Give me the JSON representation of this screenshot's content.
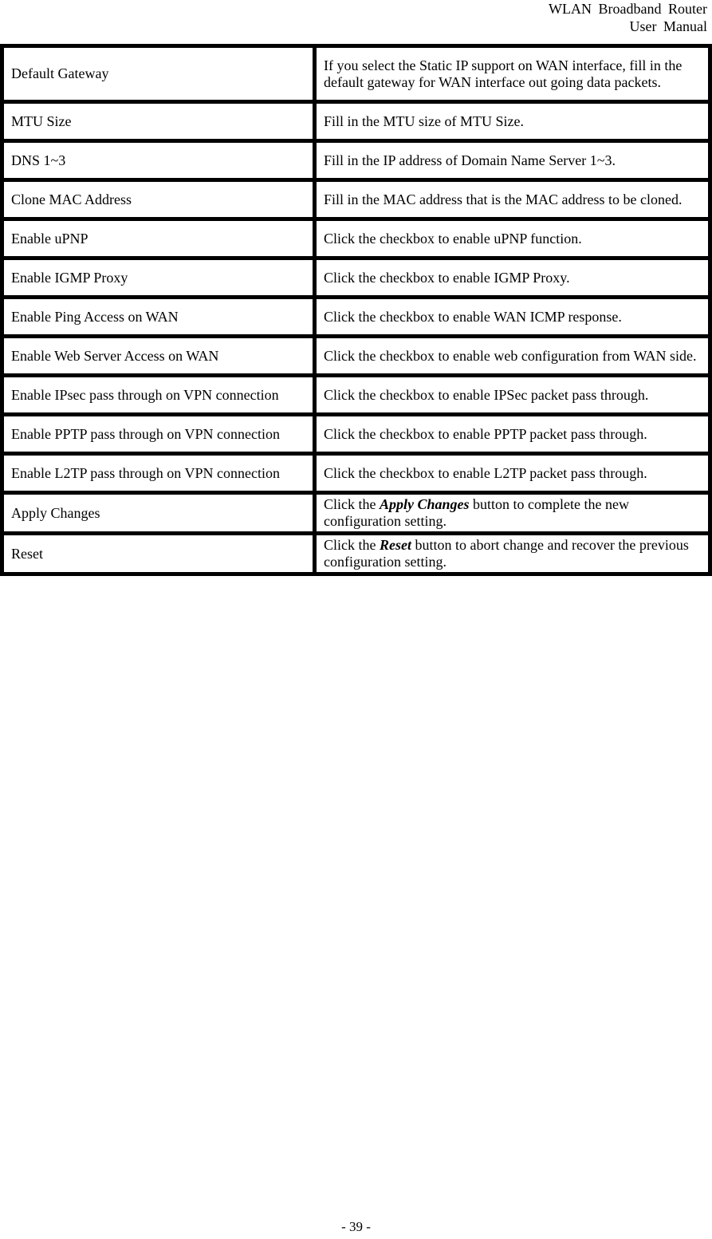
{
  "header": {
    "line1": "WLAN  Broadband  Router",
    "line2": "User  Manual"
  },
  "rows": [
    {
      "item": "Default Gateway",
      "desc": "If you select the Static IP support on WAN interface, fill in the default gateway for WAN interface out going data packets."
    },
    {
      "item": "MTU Size",
      "desc": "Fill in the MTU size of MTU Size."
    },
    {
      "item": "DNS 1~3",
      "desc": "Fill in the IP address of Domain Name Server 1~3."
    },
    {
      "item": "Clone MAC Address",
      "desc": "Fill in the MAC address that is the MAC address to be cloned."
    },
    {
      "item": "Enable uPNP",
      "desc": "Click the checkbox to enable uPNP function."
    },
    {
      "item": "Enable IGMP Proxy",
      "desc": "Click the checkbox to enable IGMP Proxy."
    },
    {
      "item": "Enable Ping Access on WAN",
      "desc": "Click the checkbox to enable WAN ICMP response."
    },
    {
      "item": "Enable Web Server Access on WAN",
      "desc": "Click the checkbox to enable web configuration from WAN side."
    },
    {
      "item": "Enable IPsec pass through on VPN connection",
      "desc": "Click the checkbox to enable IPSec packet pass through."
    },
    {
      "item": "Enable PPTP pass through on VPN connection",
      "desc": "Click the checkbox to enable PPTP packet pass through."
    },
    {
      "item": "Enable L2TP pass through on VPN connection",
      "desc": "Click the checkbox to enable L2TP packet pass through."
    },
    {
      "item": "Apply Changes",
      "desc_prefix": "Click the ",
      "desc_emph": "Apply Changes",
      "desc_suffix": " button to complete the new configuration setting."
    },
    {
      "item": "Reset",
      "desc_prefix": "Click the ",
      "desc_emph": "Reset",
      "desc_suffix": " button to abort change and recover the previous configuration setting."
    }
  ],
  "footer": {
    "page": "- 39 -"
  }
}
